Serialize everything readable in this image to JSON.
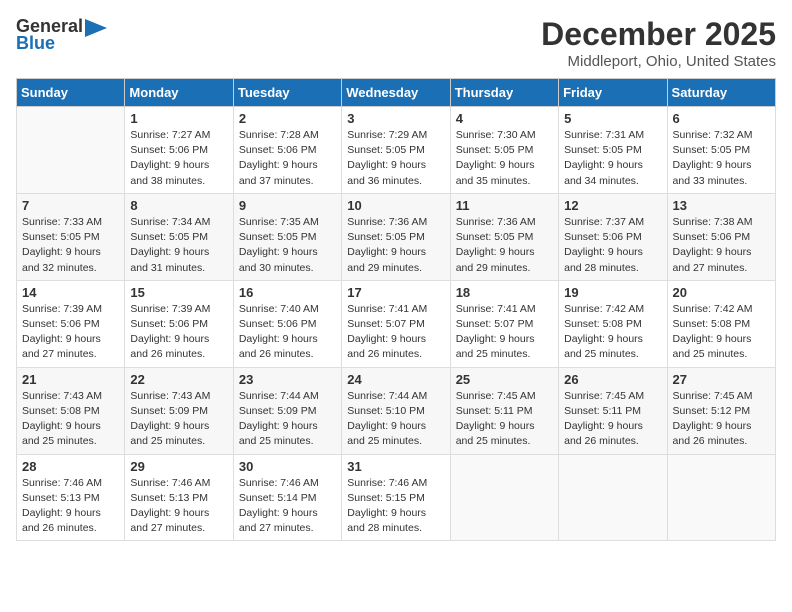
{
  "header": {
    "logo_general": "General",
    "logo_blue": "Blue",
    "month": "December 2025",
    "location": "Middleport, Ohio, United States"
  },
  "days_of_week": [
    "Sunday",
    "Monday",
    "Tuesday",
    "Wednesday",
    "Thursday",
    "Friday",
    "Saturday"
  ],
  "weeks": [
    [
      {
        "day": "",
        "info": ""
      },
      {
        "day": "1",
        "info": "Sunrise: 7:27 AM\nSunset: 5:06 PM\nDaylight: 9 hours\nand 38 minutes."
      },
      {
        "day": "2",
        "info": "Sunrise: 7:28 AM\nSunset: 5:06 PM\nDaylight: 9 hours\nand 37 minutes."
      },
      {
        "day": "3",
        "info": "Sunrise: 7:29 AM\nSunset: 5:05 PM\nDaylight: 9 hours\nand 36 minutes."
      },
      {
        "day": "4",
        "info": "Sunrise: 7:30 AM\nSunset: 5:05 PM\nDaylight: 9 hours\nand 35 minutes."
      },
      {
        "day": "5",
        "info": "Sunrise: 7:31 AM\nSunset: 5:05 PM\nDaylight: 9 hours\nand 34 minutes."
      },
      {
        "day": "6",
        "info": "Sunrise: 7:32 AM\nSunset: 5:05 PM\nDaylight: 9 hours\nand 33 minutes."
      }
    ],
    [
      {
        "day": "7",
        "info": "Sunrise: 7:33 AM\nSunset: 5:05 PM\nDaylight: 9 hours\nand 32 minutes."
      },
      {
        "day": "8",
        "info": "Sunrise: 7:34 AM\nSunset: 5:05 PM\nDaylight: 9 hours\nand 31 minutes."
      },
      {
        "day": "9",
        "info": "Sunrise: 7:35 AM\nSunset: 5:05 PM\nDaylight: 9 hours\nand 30 minutes."
      },
      {
        "day": "10",
        "info": "Sunrise: 7:36 AM\nSunset: 5:05 PM\nDaylight: 9 hours\nand 29 minutes."
      },
      {
        "day": "11",
        "info": "Sunrise: 7:36 AM\nSunset: 5:05 PM\nDaylight: 9 hours\nand 29 minutes."
      },
      {
        "day": "12",
        "info": "Sunrise: 7:37 AM\nSunset: 5:06 PM\nDaylight: 9 hours\nand 28 minutes."
      },
      {
        "day": "13",
        "info": "Sunrise: 7:38 AM\nSunset: 5:06 PM\nDaylight: 9 hours\nand 27 minutes."
      }
    ],
    [
      {
        "day": "14",
        "info": "Sunrise: 7:39 AM\nSunset: 5:06 PM\nDaylight: 9 hours\nand 27 minutes."
      },
      {
        "day": "15",
        "info": "Sunrise: 7:39 AM\nSunset: 5:06 PM\nDaylight: 9 hours\nand 26 minutes."
      },
      {
        "day": "16",
        "info": "Sunrise: 7:40 AM\nSunset: 5:06 PM\nDaylight: 9 hours\nand 26 minutes."
      },
      {
        "day": "17",
        "info": "Sunrise: 7:41 AM\nSunset: 5:07 PM\nDaylight: 9 hours\nand 26 minutes."
      },
      {
        "day": "18",
        "info": "Sunrise: 7:41 AM\nSunset: 5:07 PM\nDaylight: 9 hours\nand 25 minutes."
      },
      {
        "day": "19",
        "info": "Sunrise: 7:42 AM\nSunset: 5:08 PM\nDaylight: 9 hours\nand 25 minutes."
      },
      {
        "day": "20",
        "info": "Sunrise: 7:42 AM\nSunset: 5:08 PM\nDaylight: 9 hours\nand 25 minutes."
      }
    ],
    [
      {
        "day": "21",
        "info": "Sunrise: 7:43 AM\nSunset: 5:08 PM\nDaylight: 9 hours\nand 25 minutes."
      },
      {
        "day": "22",
        "info": "Sunrise: 7:43 AM\nSunset: 5:09 PM\nDaylight: 9 hours\nand 25 minutes."
      },
      {
        "day": "23",
        "info": "Sunrise: 7:44 AM\nSunset: 5:09 PM\nDaylight: 9 hours\nand 25 minutes."
      },
      {
        "day": "24",
        "info": "Sunrise: 7:44 AM\nSunset: 5:10 PM\nDaylight: 9 hours\nand 25 minutes."
      },
      {
        "day": "25",
        "info": "Sunrise: 7:45 AM\nSunset: 5:11 PM\nDaylight: 9 hours\nand 25 minutes."
      },
      {
        "day": "26",
        "info": "Sunrise: 7:45 AM\nSunset: 5:11 PM\nDaylight: 9 hours\nand 26 minutes."
      },
      {
        "day": "27",
        "info": "Sunrise: 7:45 AM\nSunset: 5:12 PM\nDaylight: 9 hours\nand 26 minutes."
      }
    ],
    [
      {
        "day": "28",
        "info": "Sunrise: 7:46 AM\nSunset: 5:13 PM\nDaylight: 9 hours\nand 26 minutes."
      },
      {
        "day": "29",
        "info": "Sunrise: 7:46 AM\nSunset: 5:13 PM\nDaylight: 9 hours\nand 27 minutes."
      },
      {
        "day": "30",
        "info": "Sunrise: 7:46 AM\nSunset: 5:14 PM\nDaylight: 9 hours\nand 27 minutes."
      },
      {
        "day": "31",
        "info": "Sunrise: 7:46 AM\nSunset: 5:15 PM\nDaylight: 9 hours\nand 28 minutes."
      },
      {
        "day": "",
        "info": ""
      },
      {
        "day": "",
        "info": ""
      },
      {
        "day": "",
        "info": ""
      }
    ]
  ]
}
